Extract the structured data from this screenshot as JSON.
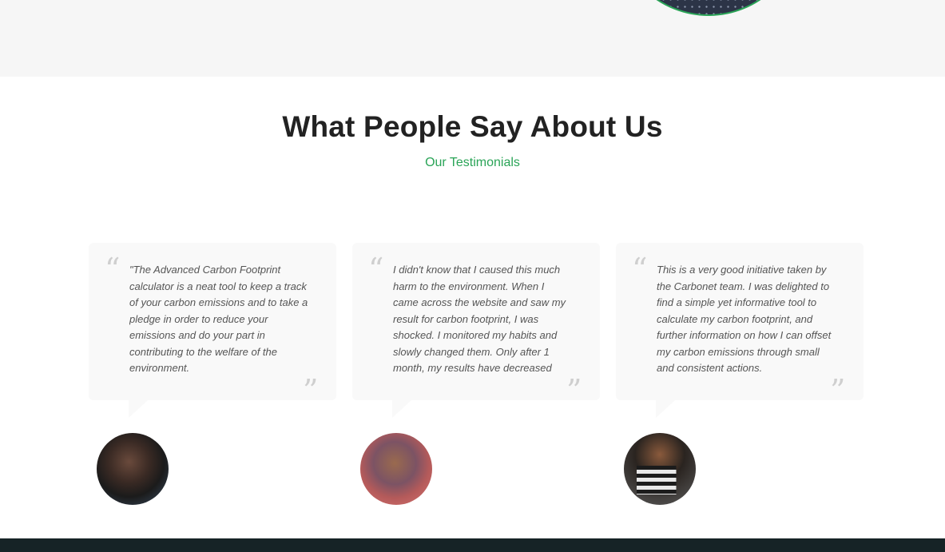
{
  "section": {
    "title": "What People Say About Us",
    "subtitle": "Our Testimonials"
  },
  "colors": {
    "accent": "#2aa457",
    "heading": "#222222",
    "card_bg": "#f9f9f9",
    "footer_bg": "#162326"
  },
  "testimonials": [
    {
      "quote": "\"The Advanced Carbon Footprint calculator is a neat tool to keep a track of your carbon emissions and to take a pledge in order to reduce your emissions and do your part in contributing to the welfare of the environment.",
      "avatar_icon": "person-photo"
    },
    {
      "quote": "I didn't know that I caused this much harm to the environment. When I came across the website and saw my result for carbon footprint, I was shocked. I monitored my habits and slowly changed them. Only after 1 month, my results have decreased",
      "avatar_icon": "person-photo"
    },
    {
      "quote": "This is a very good initiative taken by the Carbonet team. I was delighted to find a simple yet informative tool to calculate my carbon footprint, and further information on how I can offset my carbon emissions through small and consistent actions.",
      "avatar_icon": "person-photo"
    }
  ],
  "quote_marks": {
    "open": "“",
    "close": "”"
  }
}
